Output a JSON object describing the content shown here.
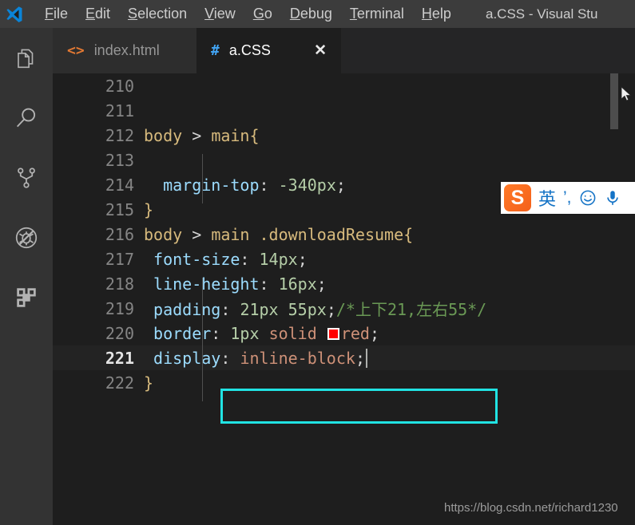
{
  "window": {
    "title": "a.CSS - Visual Stu",
    "logo_icon": "vscode-logo-icon"
  },
  "menubar": {
    "items": [
      {
        "mnemonic": "F",
        "rest": "ile"
      },
      {
        "mnemonic": "E",
        "rest": "dit"
      },
      {
        "pre": "",
        "mnemonic": "S",
        "rest": "election"
      },
      {
        "mnemonic": "V",
        "rest": "iew"
      },
      {
        "mnemonic": "G",
        "rest": "o"
      },
      {
        "mnemonic": "D",
        "rest": "ebug"
      },
      {
        "mnemonic": "T",
        "rest": "erminal"
      },
      {
        "mnemonic": "H",
        "rest": "elp"
      }
    ]
  },
  "activitybar": {
    "items": [
      {
        "name": "explorer-icon",
        "label": "Explorer"
      },
      {
        "name": "search-icon",
        "label": "Search"
      },
      {
        "name": "source-control-icon",
        "label": "Source Control"
      },
      {
        "name": "run-debug-icon",
        "label": "Run and Debug"
      },
      {
        "name": "extensions-icon",
        "label": "Extensions"
      }
    ]
  },
  "tabs": [
    {
      "label": "index.html",
      "icon": "<>",
      "icon_name": "html-file-icon",
      "active": false,
      "closable": false
    },
    {
      "label": "a.CSS",
      "icon": "#",
      "icon_name": "css-file-icon",
      "active": true,
      "closable": true,
      "close_label": "✕"
    }
  ],
  "editor": {
    "first_line": 210,
    "current_line": 221,
    "lines": [
      {
        "n": "210",
        "segments": []
      },
      {
        "n": "211",
        "segments": []
      },
      {
        "n": "212",
        "segments": [
          {
            "t": "body ",
            "c": "sel"
          },
          {
            "t": "> ",
            "c": "comb"
          },
          {
            "t": "main",
            "c": "sel"
          },
          {
            "t": "{",
            "c": "brace"
          }
        ]
      },
      {
        "n": "213",
        "segments": []
      },
      {
        "n": "214",
        "segments": [
          {
            "t": "  ",
            "c": "punc"
          },
          {
            "t": "margin-top",
            "c": "prop"
          },
          {
            "t": ": ",
            "c": "punc"
          },
          {
            "t": "-340px",
            "c": "num"
          },
          {
            "t": ";",
            "c": "punc"
          }
        ]
      },
      {
        "n": "215",
        "segments": [
          {
            "t": "}",
            "c": "brace"
          }
        ]
      },
      {
        "n": "216",
        "segments": [
          {
            "t": "body ",
            "c": "sel"
          },
          {
            "t": "> ",
            "c": "comb"
          },
          {
            "t": "main .downloadResume",
            "c": "sel"
          },
          {
            "t": "{",
            "c": "brace"
          }
        ]
      },
      {
        "n": "217",
        "segments": [
          {
            "t": " ",
            "c": "punc"
          },
          {
            "t": "font-size",
            "c": "prop"
          },
          {
            "t": ": ",
            "c": "punc"
          },
          {
            "t": "14px",
            "c": "num"
          },
          {
            "t": ";",
            "c": "punc"
          }
        ]
      },
      {
        "n": "218",
        "segments": [
          {
            "t": " ",
            "c": "punc"
          },
          {
            "t": "line-height",
            "c": "prop"
          },
          {
            "t": ": ",
            "c": "punc"
          },
          {
            "t": "16px",
            "c": "num"
          },
          {
            "t": ";",
            "c": "punc"
          }
        ]
      },
      {
        "n": "219",
        "segments": [
          {
            "t": " ",
            "c": "punc"
          },
          {
            "t": "padding",
            "c": "prop"
          },
          {
            "t": ": ",
            "c": "punc"
          },
          {
            "t": "21px 55px",
            "c": "num"
          },
          {
            "t": ";",
            "c": "punc"
          },
          {
            "t": "/*上下21,左右55*/",
            "c": "cmt"
          }
        ]
      },
      {
        "n": "220",
        "segments": [
          {
            "t": " ",
            "c": "punc"
          },
          {
            "t": "border",
            "c": "prop"
          },
          {
            "t": ": ",
            "c": "punc"
          },
          {
            "t": "1px",
            "c": "num"
          },
          {
            "t": " ",
            "c": "punc"
          },
          {
            "t": "solid",
            "c": "kw"
          },
          {
            "t": " ",
            "c": "punc"
          },
          {
            "t": "__SWATCH__",
            "c": "swatch"
          },
          {
            "t": "red",
            "c": "kw"
          },
          {
            "t": ";",
            "c": "punc"
          }
        ]
      },
      {
        "n": "221",
        "segments": [
          {
            "t": " ",
            "c": "punc"
          },
          {
            "t": "display",
            "c": "prop"
          },
          {
            "t": ": ",
            "c": "punc"
          },
          {
            "t": "inline-block",
            "c": "kw"
          },
          {
            "t": ";",
            "c": "punc"
          },
          {
            "t": "__CURSOR__",
            "c": "cursor"
          }
        ]
      },
      {
        "n": "222",
        "segments": [
          {
            "t": "}",
            "c": "brace"
          }
        ]
      }
    ],
    "annotation": {
      "name": "highlight-rectangle",
      "color": "#21e3e3",
      "targets_line": "221"
    },
    "swatch_color": "#ff0000"
  },
  "ime": {
    "name": "sogou-ime-toolbar",
    "logo_text": "S",
    "items": [
      {
        "name": "ime-language-mode",
        "glyph": "英"
      },
      {
        "name": "ime-punctuation-toggle",
        "glyph": "’,"
      },
      {
        "name": "ime-emoji-button",
        "glyph": "☺"
      },
      {
        "name": "ime-voice-input-button",
        "glyph": "🎤"
      }
    ]
  },
  "watermark": {
    "text": "https://blog.csdn.net/richard1230"
  }
}
